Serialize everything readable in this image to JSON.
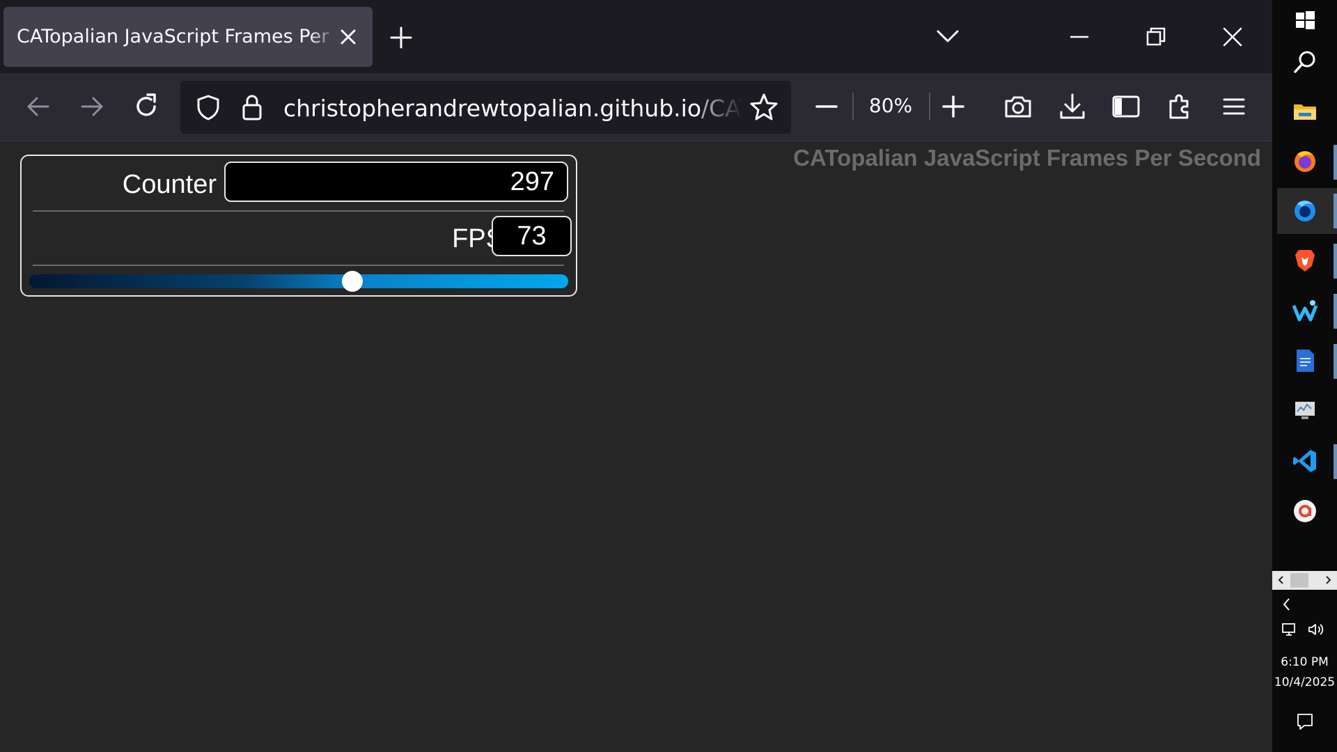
{
  "browser": {
    "tab_title": "CATopalian JavaScript Frames Per Second",
    "url_host": "christopherandrewtopalian.github.io",
    "url_path": "/CATopalian",
    "zoom_level": "80%"
  },
  "page": {
    "heading": "CATopalian JavaScript Frames Per Second",
    "counter_label": "Counter",
    "counter_value": "297",
    "fps_label": "FPS",
    "fps_value": "73",
    "slider_position": 0.6
  },
  "taskbar": {
    "time": "6:10 PM",
    "date": "10/4/2025",
    "pinned_apps": [
      "windows-start-icon",
      "search-icon",
      "file-explorer-icon",
      "firefox-icon",
      "firefox-developer-icon",
      "brave-icon",
      "waterfox-icon",
      "document-editor-icon",
      "system-monitor-icon",
      "vscode-icon",
      "app-red-icon"
    ]
  },
  "colors": {
    "slider_start": "#021832",
    "slider_end": "#00a8ee",
    "panel_border": "#e6e6e6",
    "heading_gray": "#6b6b6b"
  }
}
